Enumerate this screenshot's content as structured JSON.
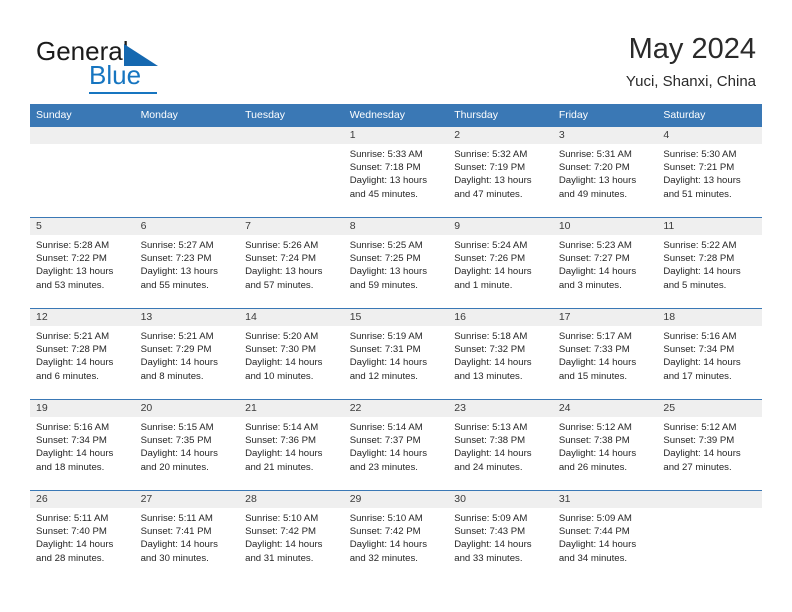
{
  "brand": {
    "name_part1": "General",
    "name_part2": "Blue"
  },
  "header": {
    "title": "May 2024",
    "subtitle": "Yuci, Shanxi, China"
  },
  "colors": {
    "header_blue": "#3a78b5",
    "brand_blue": "#1675c0",
    "daynum_band": "#efefef"
  },
  "weekday_headers": [
    "Sunday",
    "Monday",
    "Tuesday",
    "Wednesday",
    "Thursday",
    "Friday",
    "Saturday"
  ],
  "weeks": [
    [
      {
        "day": "",
        "lines": []
      },
      {
        "day": "",
        "lines": []
      },
      {
        "day": "",
        "lines": []
      },
      {
        "day": "1",
        "lines": [
          "Sunrise: 5:33 AM",
          "Sunset: 7:18 PM",
          "Daylight: 13 hours",
          "and 45 minutes."
        ]
      },
      {
        "day": "2",
        "lines": [
          "Sunrise: 5:32 AM",
          "Sunset: 7:19 PM",
          "Daylight: 13 hours",
          "and 47 minutes."
        ]
      },
      {
        "day": "3",
        "lines": [
          "Sunrise: 5:31 AM",
          "Sunset: 7:20 PM",
          "Daylight: 13 hours",
          "and 49 minutes."
        ]
      },
      {
        "day": "4",
        "lines": [
          "Sunrise: 5:30 AM",
          "Sunset: 7:21 PM",
          "Daylight: 13 hours",
          "and 51 minutes."
        ]
      }
    ],
    [
      {
        "day": "5",
        "lines": [
          "Sunrise: 5:28 AM",
          "Sunset: 7:22 PM",
          "Daylight: 13 hours",
          "and 53 minutes."
        ]
      },
      {
        "day": "6",
        "lines": [
          "Sunrise: 5:27 AM",
          "Sunset: 7:23 PM",
          "Daylight: 13 hours",
          "and 55 minutes."
        ]
      },
      {
        "day": "7",
        "lines": [
          "Sunrise: 5:26 AM",
          "Sunset: 7:24 PM",
          "Daylight: 13 hours",
          "and 57 minutes."
        ]
      },
      {
        "day": "8",
        "lines": [
          "Sunrise: 5:25 AM",
          "Sunset: 7:25 PM",
          "Daylight: 13 hours",
          "and 59 minutes."
        ]
      },
      {
        "day": "9",
        "lines": [
          "Sunrise: 5:24 AM",
          "Sunset: 7:26 PM",
          "Daylight: 14 hours",
          "and 1 minute."
        ]
      },
      {
        "day": "10",
        "lines": [
          "Sunrise: 5:23 AM",
          "Sunset: 7:27 PM",
          "Daylight: 14 hours",
          "and 3 minutes."
        ]
      },
      {
        "day": "11",
        "lines": [
          "Sunrise: 5:22 AM",
          "Sunset: 7:28 PM",
          "Daylight: 14 hours",
          "and 5 minutes."
        ]
      }
    ],
    [
      {
        "day": "12",
        "lines": [
          "Sunrise: 5:21 AM",
          "Sunset: 7:28 PM",
          "Daylight: 14 hours",
          "and 6 minutes."
        ]
      },
      {
        "day": "13",
        "lines": [
          "Sunrise: 5:21 AM",
          "Sunset: 7:29 PM",
          "Daylight: 14 hours",
          "and 8 minutes."
        ]
      },
      {
        "day": "14",
        "lines": [
          "Sunrise: 5:20 AM",
          "Sunset: 7:30 PM",
          "Daylight: 14 hours",
          "and 10 minutes."
        ]
      },
      {
        "day": "15",
        "lines": [
          "Sunrise: 5:19 AM",
          "Sunset: 7:31 PM",
          "Daylight: 14 hours",
          "and 12 minutes."
        ]
      },
      {
        "day": "16",
        "lines": [
          "Sunrise: 5:18 AM",
          "Sunset: 7:32 PM",
          "Daylight: 14 hours",
          "and 13 minutes."
        ]
      },
      {
        "day": "17",
        "lines": [
          "Sunrise: 5:17 AM",
          "Sunset: 7:33 PM",
          "Daylight: 14 hours",
          "and 15 minutes."
        ]
      },
      {
        "day": "18",
        "lines": [
          "Sunrise: 5:16 AM",
          "Sunset: 7:34 PM",
          "Daylight: 14 hours",
          "and 17 minutes."
        ]
      }
    ],
    [
      {
        "day": "19",
        "lines": [
          "Sunrise: 5:16 AM",
          "Sunset: 7:34 PM",
          "Daylight: 14 hours",
          "and 18 minutes."
        ]
      },
      {
        "day": "20",
        "lines": [
          "Sunrise: 5:15 AM",
          "Sunset: 7:35 PM",
          "Daylight: 14 hours",
          "and 20 minutes."
        ]
      },
      {
        "day": "21",
        "lines": [
          "Sunrise: 5:14 AM",
          "Sunset: 7:36 PM",
          "Daylight: 14 hours",
          "and 21 minutes."
        ]
      },
      {
        "day": "22",
        "lines": [
          "Sunrise: 5:14 AM",
          "Sunset: 7:37 PM",
          "Daylight: 14 hours",
          "and 23 minutes."
        ]
      },
      {
        "day": "23",
        "lines": [
          "Sunrise: 5:13 AM",
          "Sunset: 7:38 PM",
          "Daylight: 14 hours",
          "and 24 minutes."
        ]
      },
      {
        "day": "24",
        "lines": [
          "Sunrise: 5:12 AM",
          "Sunset: 7:38 PM",
          "Daylight: 14 hours",
          "and 26 minutes."
        ]
      },
      {
        "day": "25",
        "lines": [
          "Sunrise: 5:12 AM",
          "Sunset: 7:39 PM",
          "Daylight: 14 hours",
          "and 27 minutes."
        ]
      }
    ],
    [
      {
        "day": "26",
        "lines": [
          "Sunrise: 5:11 AM",
          "Sunset: 7:40 PM",
          "Daylight: 14 hours",
          "and 28 minutes."
        ]
      },
      {
        "day": "27",
        "lines": [
          "Sunrise: 5:11 AM",
          "Sunset: 7:41 PM",
          "Daylight: 14 hours",
          "and 30 minutes."
        ]
      },
      {
        "day": "28",
        "lines": [
          "Sunrise: 5:10 AM",
          "Sunset: 7:42 PM",
          "Daylight: 14 hours",
          "and 31 minutes."
        ]
      },
      {
        "day": "29",
        "lines": [
          "Sunrise: 5:10 AM",
          "Sunset: 7:42 PM",
          "Daylight: 14 hours",
          "and 32 minutes."
        ]
      },
      {
        "day": "30",
        "lines": [
          "Sunrise: 5:09 AM",
          "Sunset: 7:43 PM",
          "Daylight: 14 hours",
          "and 33 minutes."
        ]
      },
      {
        "day": "31",
        "lines": [
          "Sunrise: 5:09 AM",
          "Sunset: 7:44 PM",
          "Daylight: 14 hours",
          "and 34 minutes."
        ]
      },
      {
        "day": "",
        "lines": []
      }
    ]
  ]
}
